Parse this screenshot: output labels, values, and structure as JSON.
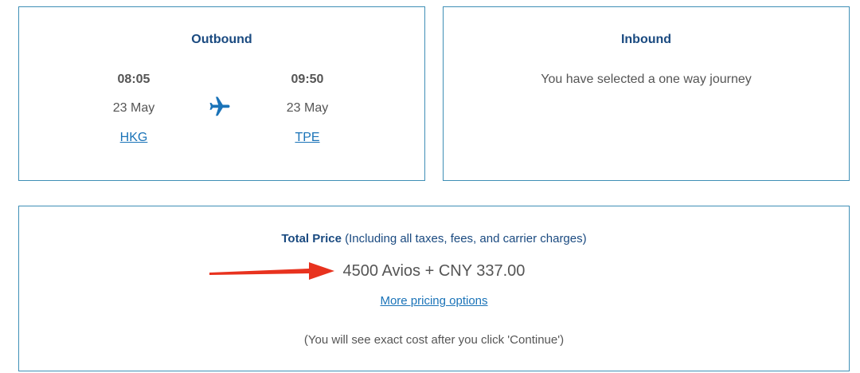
{
  "outbound": {
    "title": "Outbound",
    "departure": {
      "time": "08:05",
      "date": "23 May",
      "airport": "HKG"
    },
    "arrival": {
      "time": "09:50",
      "date": "23 May",
      "airport": "TPE"
    },
    "icon": "plane-icon"
  },
  "inbound": {
    "title": "Inbound",
    "message": "You have selected a one way journey"
  },
  "price": {
    "label": "Total Price",
    "label_suffix": " (Including all taxes, fees, and carrier charges)",
    "amount": "4500 Avios + CNY 337.00",
    "more_options": "More pricing options",
    "note": "(You will see exact cost after you click 'Continue')"
  },
  "colors": {
    "border": "#3f8fb6",
    "heading": "#1a4a80",
    "link": "#1a73b8",
    "arrow": "#e8321e"
  }
}
